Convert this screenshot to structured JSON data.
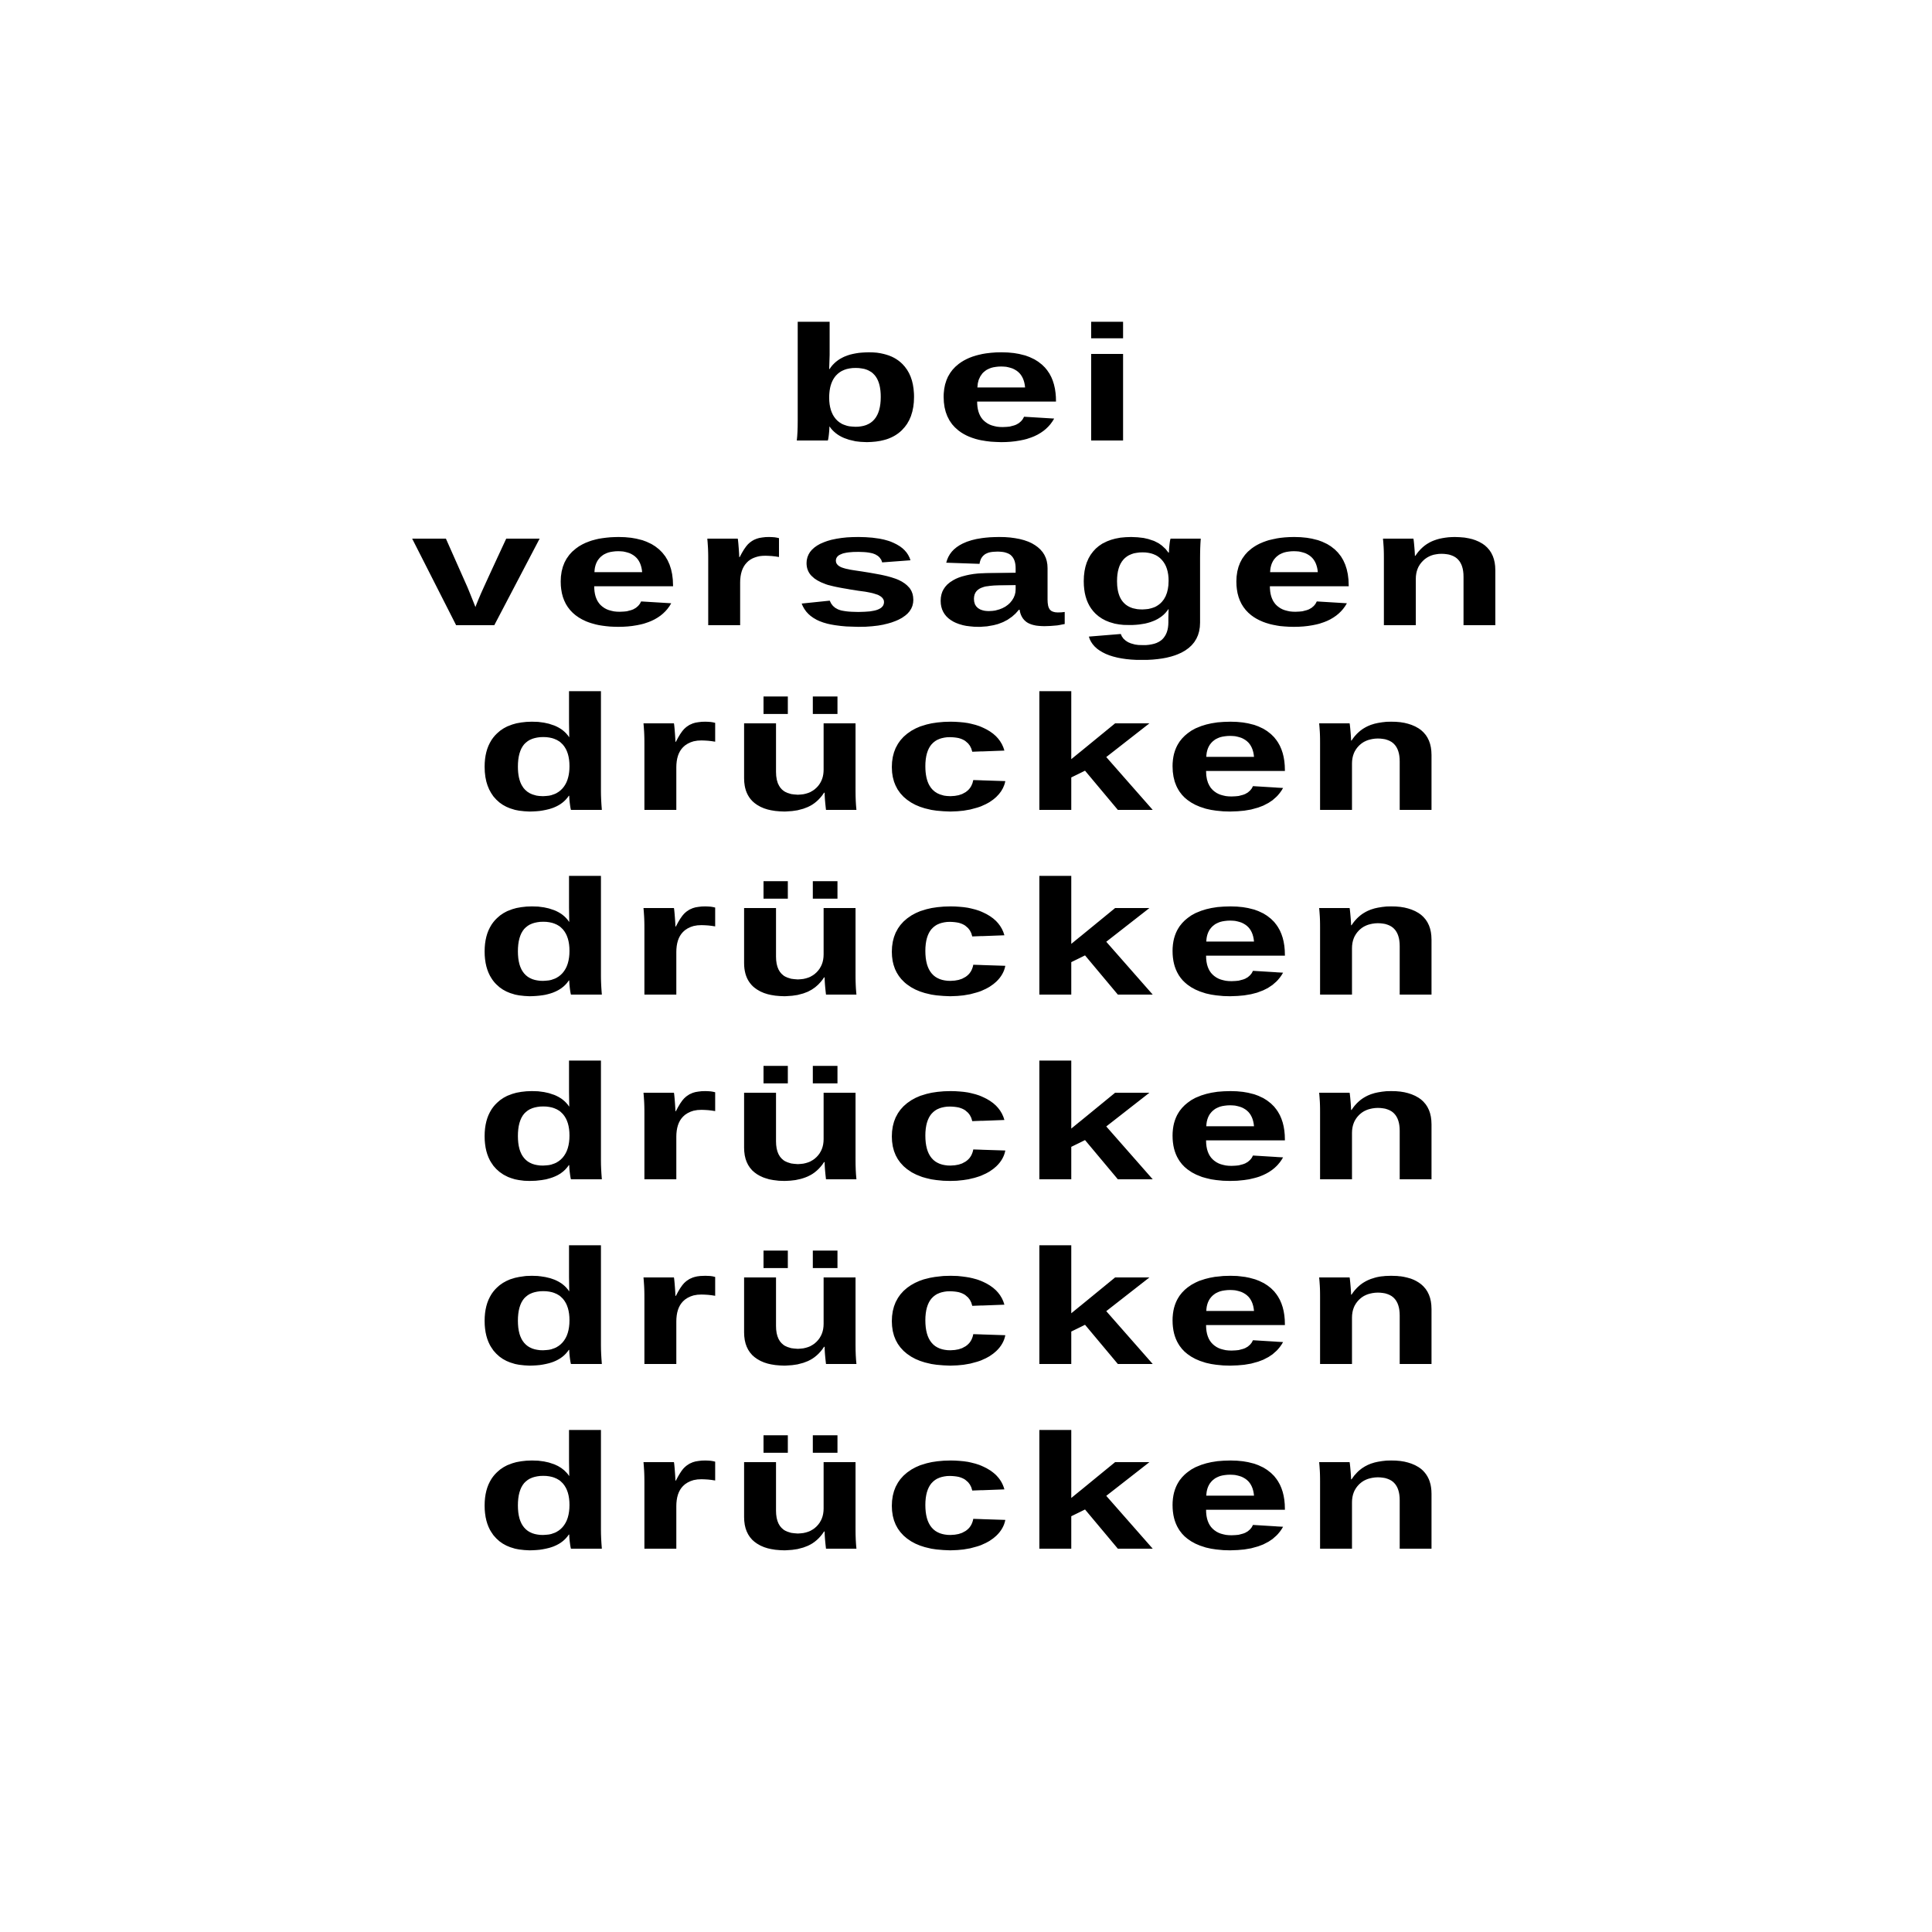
{
  "colors": {
    "background": "#ffffff",
    "text": "#000000"
  },
  "lines": [
    "bei",
    "versagen",
    "drücken",
    "drücken",
    "drücken",
    "drücken",
    "drücken"
  ]
}
